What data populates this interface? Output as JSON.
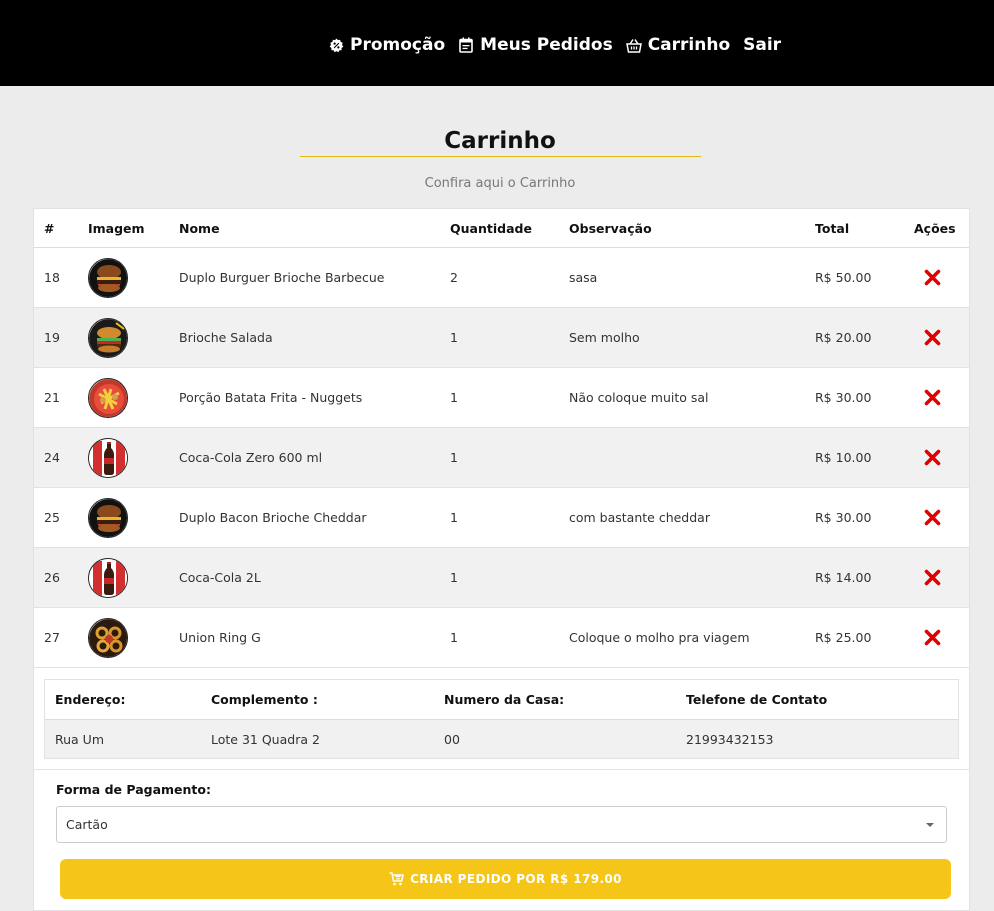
{
  "nav": {
    "promo": "Promoção",
    "orders": "Meus Pedidos",
    "cart": "Carrinho",
    "logout": "Sair"
  },
  "page": {
    "title": "Carrinho",
    "subtitle": "Confira aqui o Carrinho"
  },
  "table": {
    "headers": {
      "id": "#",
      "image": "Imagem",
      "name": "Nome",
      "qty": "Quantidade",
      "note": "Observação",
      "total": "Total",
      "actions": "Ações"
    },
    "rows": [
      {
        "id": "18",
        "name": "Duplo Burguer Brioche Barbecue",
        "qty": "2",
        "note": "sasa",
        "total": "R$ 50.00",
        "thumb": "burger"
      },
      {
        "id": "19",
        "name": "Brioche Salada",
        "qty": "1",
        "note": "Sem molho",
        "total": "R$ 20.00",
        "thumb": "salad-burger"
      },
      {
        "id": "21",
        "name": "Porção Batata Frita - Nuggets",
        "qty": "1",
        "note": "Não coloque muito sal",
        "total": "R$ 30.00",
        "thumb": "fries"
      },
      {
        "id": "24",
        "name": "Coca-Cola Zero 600 ml",
        "qty": "1",
        "note": "",
        "total": "R$ 10.00",
        "thumb": "coke-bottle"
      },
      {
        "id": "25",
        "name": "Duplo Bacon Brioche Cheddar",
        "qty": "1",
        "note": "com bastante cheddar",
        "total": "R$ 30.00",
        "thumb": "burger"
      },
      {
        "id": "26",
        "name": "Coca-Cola 2L",
        "qty": "1",
        "note": "",
        "total": "R$ 14.00",
        "thumb": "coke-bottle"
      },
      {
        "id": "27",
        "name": "Union Ring G",
        "qty": "1",
        "note": "Coloque o molho pra viagem",
        "total": "R$ 25.00",
        "thumb": "onion-rings"
      }
    ]
  },
  "address": {
    "headers": {
      "street": "Endereço:",
      "complement": "Complemento :",
      "number": "Numero da Casa:",
      "phone": "Telefone de Contato"
    },
    "values": {
      "street": "Rua Um",
      "complement": "Lote 31 Quadra 2",
      "number": "00",
      "phone": "21993432153"
    }
  },
  "payment": {
    "label": "Forma de Pagamento:",
    "selected": "Cartão"
  },
  "submit": {
    "label": "CRIAR PEDIDO POR R$ 179.00"
  },
  "colors": {
    "accent": "#f5c518",
    "delete": "#e00000",
    "topbar": "#000000"
  }
}
